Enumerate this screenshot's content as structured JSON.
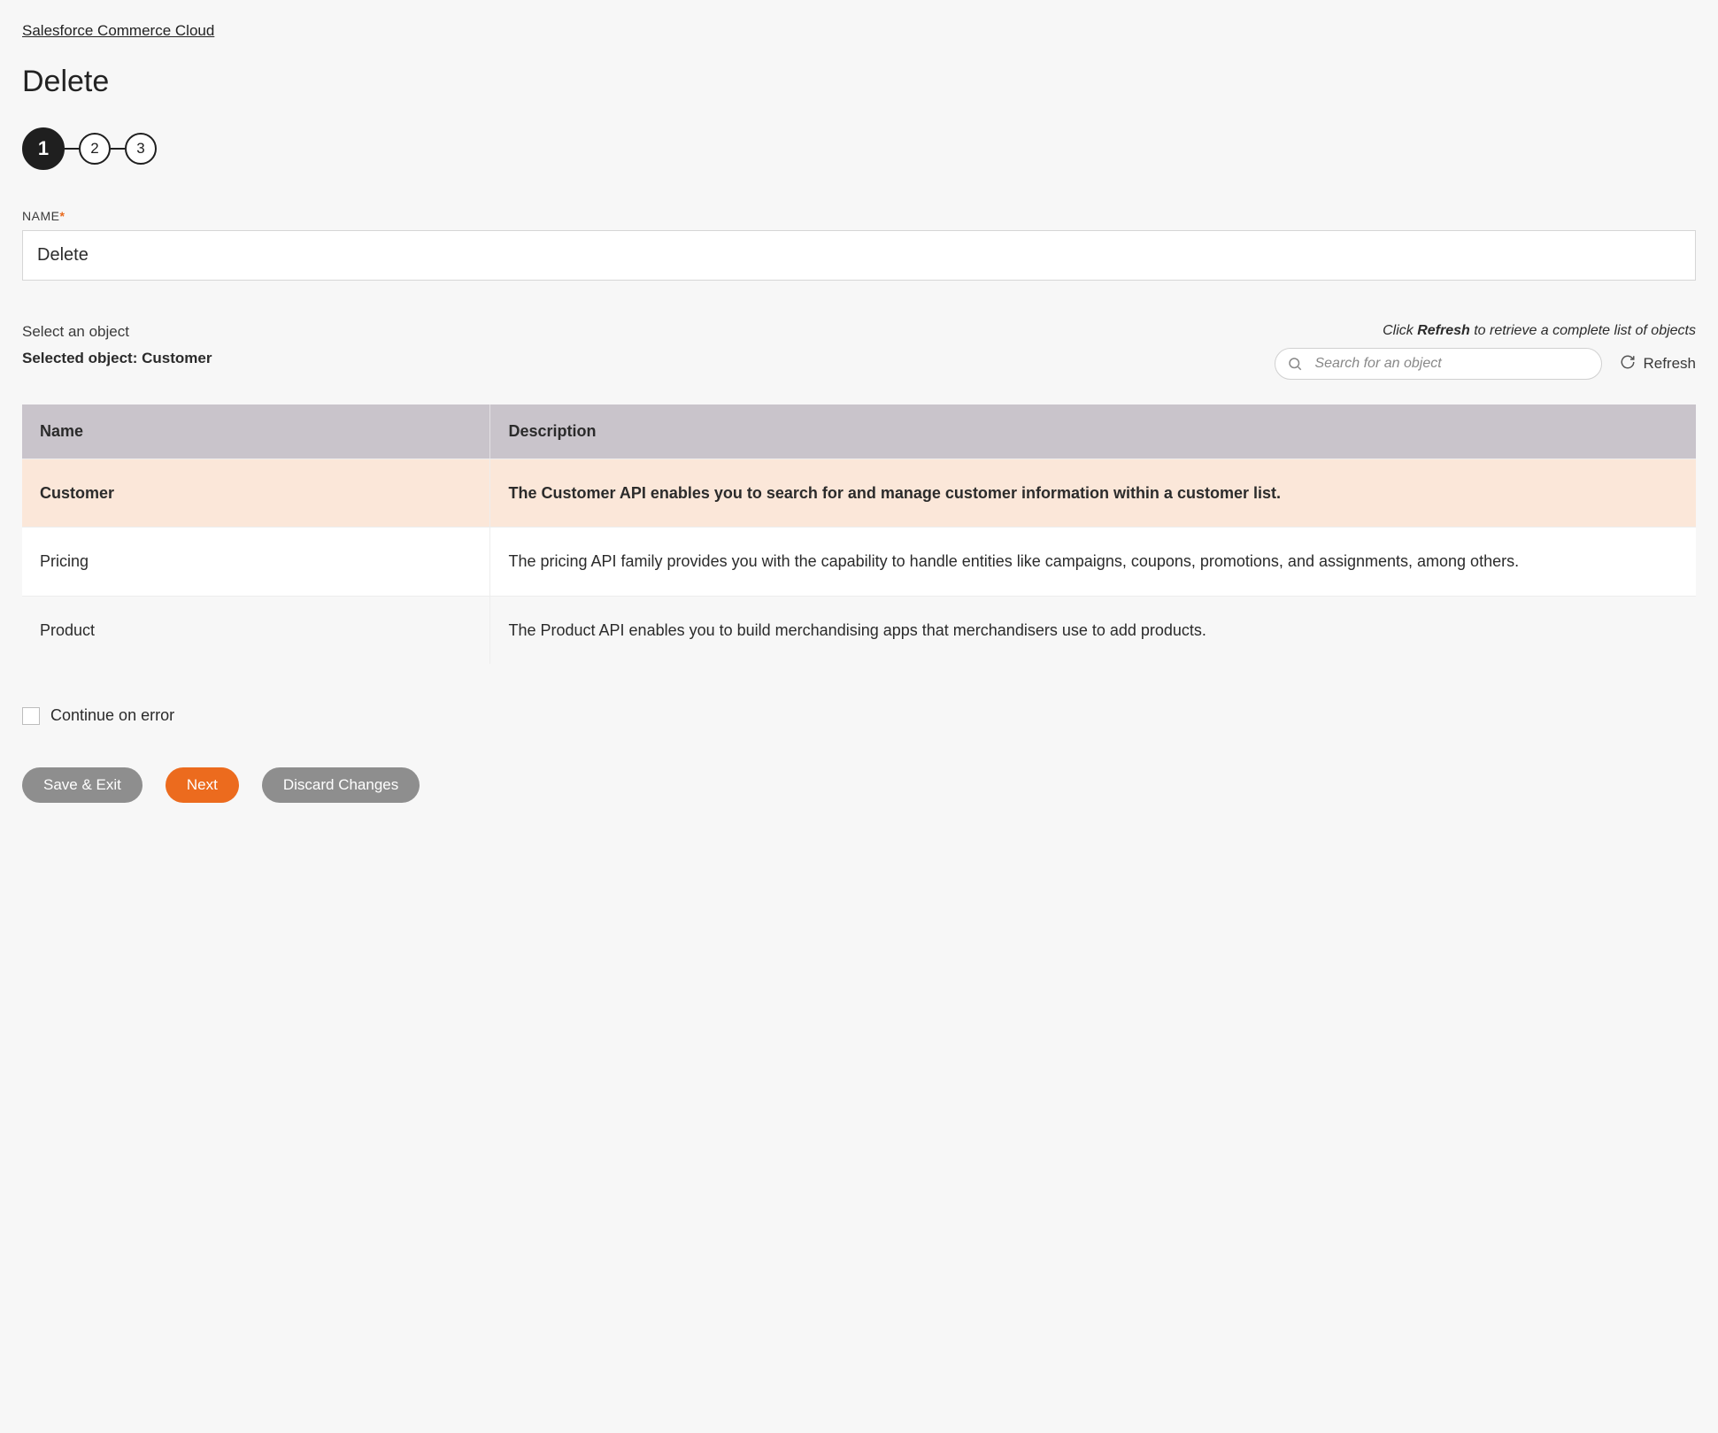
{
  "breadcrumb": "Salesforce Commerce Cloud",
  "page_title": "Delete",
  "stepper": {
    "steps": [
      "1",
      "2",
      "3"
    ],
    "active_index": 0
  },
  "name_field": {
    "label": "NAME",
    "required_mark": "*",
    "value": "Delete"
  },
  "select": {
    "prompt": "Select an object",
    "selected_prefix": "Selected object: ",
    "selected_value": "Customer",
    "refresh_hint_pre": "Click ",
    "refresh_hint_bold": "Refresh",
    "refresh_hint_post": " to retrieve a complete list of objects",
    "search_placeholder": "Search for an object",
    "refresh_label": "Refresh"
  },
  "table": {
    "headers": {
      "name": "Name",
      "description": "Description"
    },
    "rows": [
      {
        "name": "Customer",
        "description": "The Customer API enables you to search for and manage customer information within a customer list.",
        "selected": true
      },
      {
        "name": "Pricing",
        "description": "The pricing API family provides you with the capability to handle entities like campaigns, coupons, promotions, and assignments, among others.",
        "selected": false
      },
      {
        "name": "Product",
        "description": "The Product API enables you to build merchandising apps that merchandisers use to add products.",
        "selected": false
      }
    ]
  },
  "continue_on_error_label": "Continue on error",
  "buttons": {
    "save_exit": "Save & Exit",
    "next": "Next",
    "discard": "Discard Changes"
  }
}
